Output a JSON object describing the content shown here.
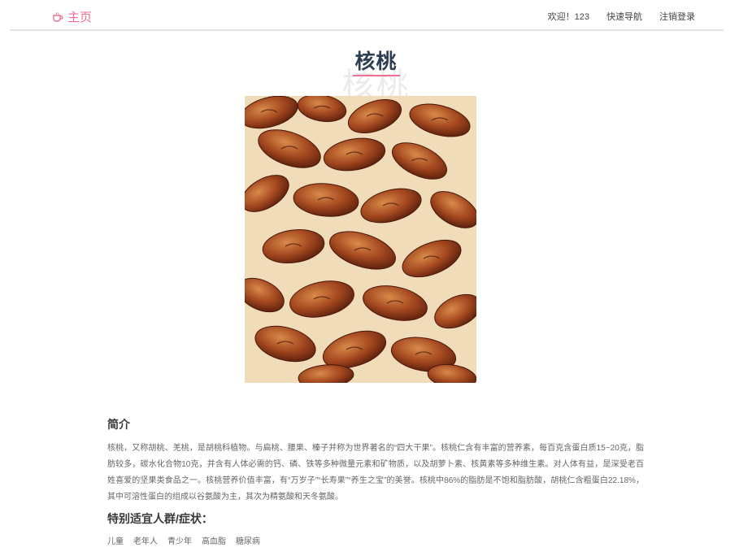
{
  "nav": {
    "brand_label": "主页",
    "brand_icon": "cup-icon",
    "welcome": "欢迎！123",
    "quick_nav": "快速导航",
    "logout": "注销登录"
  },
  "page": {
    "title": "核桃",
    "watermark_title": "核桃",
    "image_subject": "walnut-photo"
  },
  "intro": {
    "heading": "简介",
    "body": "核桃，又称胡桃、羌桃，是胡桃科植物。与扁桃、腰果、榛子并称为世界著名的“四大干果”。核桃仁含有丰富的营养素，每百克含蛋白质15~20克，脂肪较多，碳水化合物10克，并含有人体必需的钙、磷、铁等多种微量元素和矿物质，以及胡萝卜素、核黄素等多种维生素。对人体有益，是深受老百姓喜爱的坚果类食品之一。核桃营养价值丰富，有“万岁子”“长寿果”“养生之宝”的美誉。核桃中86%的脂肪是不饱和脂肪酸，胡桃仁含粗蛋白22.18%，其中可溶性蛋白的组成以谷氨酸为主，其次为精氨酸和天冬氨酸。"
  },
  "suitable": {
    "heading": "特别适宜人群/症状：",
    "tags": [
      "儿童",
      "老年人",
      "青少年",
      "高血脂",
      "糖尿病"
    ]
  },
  "colors": {
    "accent": "#ef6f93",
    "title": "#2c3e50",
    "text": "#666666"
  }
}
